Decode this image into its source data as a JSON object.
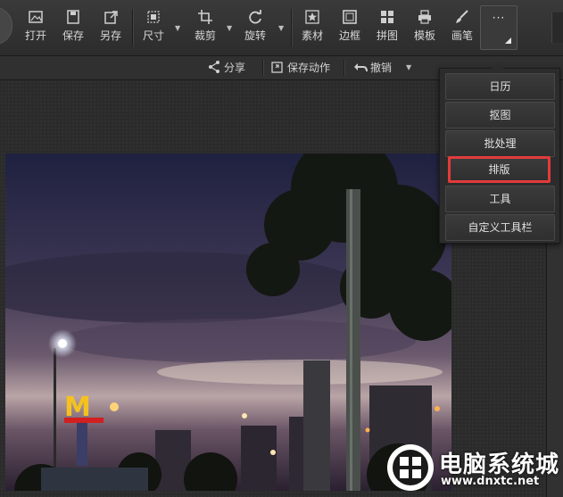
{
  "toolbar": {
    "open": "打开",
    "save": "保存",
    "save_as": "另存",
    "size": "尺寸",
    "crop": "裁剪",
    "rotate": "旋转",
    "material": "素材",
    "border": "边框",
    "collage": "拼图",
    "template": "模板",
    "brush": "画笔",
    "more": "···"
  },
  "subbar": {
    "share": "分享",
    "save_action": "保存动作",
    "undo": "撤销"
  },
  "dropdown": {
    "items": [
      "日历",
      "抠图",
      "批处理",
      "排版",
      "工具",
      "自定义工具栏"
    ],
    "highlighted_index": 3
  },
  "watermark": {
    "title": "电脑系统城",
    "url": "www.dnxtc.net"
  },
  "colors": {
    "highlight": "#e23b3b",
    "toolbar_bg": "#333333"
  }
}
